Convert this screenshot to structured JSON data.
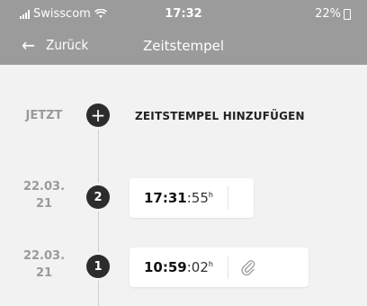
{
  "status_bar": {
    "carrier": "Swisscom",
    "time": "17:32",
    "battery": "22%"
  },
  "nav": {
    "back_label": "Zurück",
    "title": "Zeitstempel"
  },
  "add_row": {
    "date": "JETZT",
    "label": "ZEITSTEMPEL HINZUFÜGEN"
  },
  "entries": [
    {
      "date_line1": "22.03.",
      "date_line2": "21",
      "number": "2",
      "hours_minutes": "17:31",
      "seconds": ":55",
      "suffix": "h",
      "attachment": false
    },
    {
      "date_line1": "22.03.",
      "date_line2": "21",
      "number": "1",
      "hours_minutes": "10:59",
      "seconds": ":02",
      "suffix": "h",
      "attachment": true
    }
  ],
  "icons": {
    "back": "arrow-left-icon",
    "wifi": "wifi-icon",
    "signal": "signal-icon",
    "battery": "battery-icon",
    "add": "plus-icon",
    "attachment": "paperclip-icon"
  }
}
